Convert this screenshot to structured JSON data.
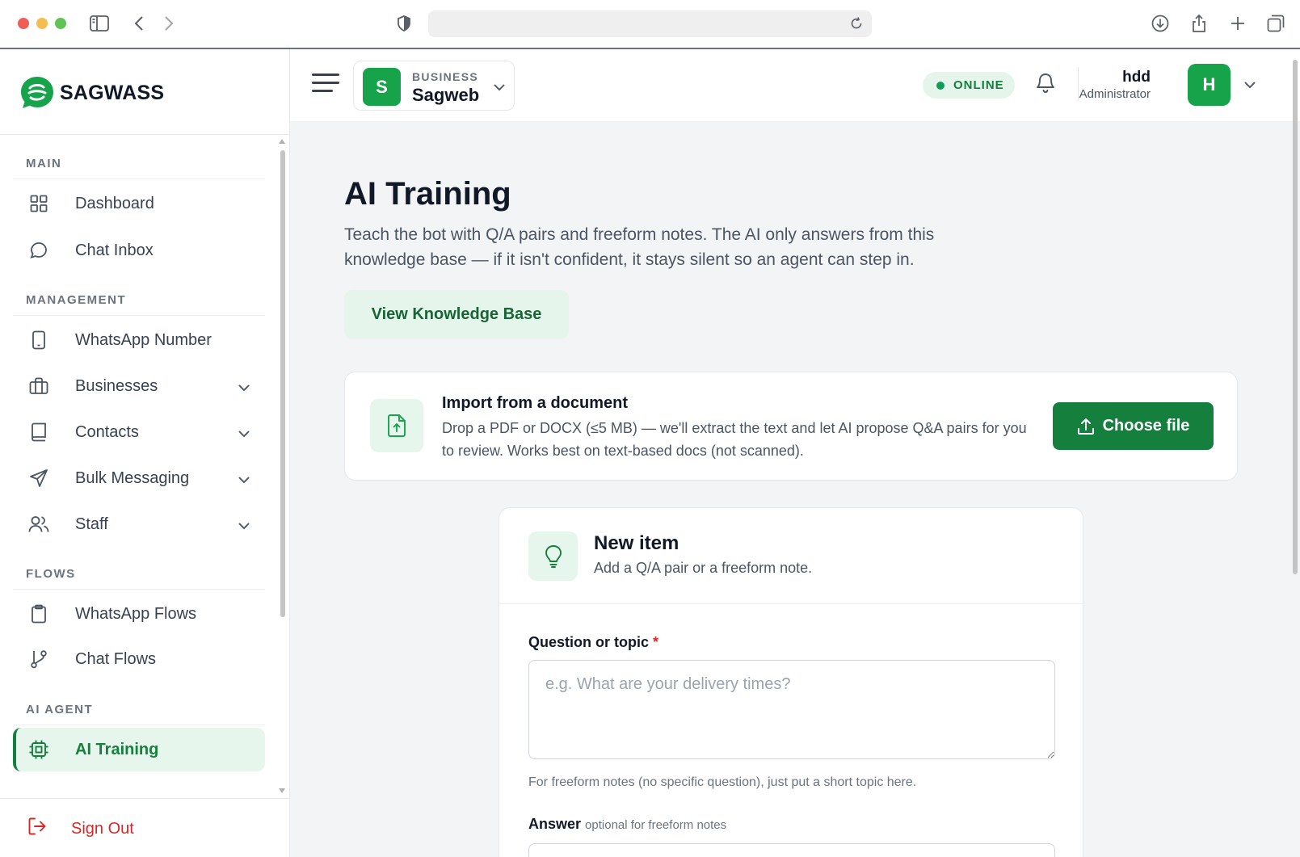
{
  "browser": {
    "url": ""
  },
  "brand": {
    "name": "SAGWASS",
    "accent": "#15803d",
    "accent_light": "#e7f6ec"
  },
  "sidebar": {
    "sections": [
      {
        "title": "MAIN",
        "items": [
          {
            "label": "Dashboard",
            "icon": "grid-icon",
            "expandable": false
          },
          {
            "label": "Chat Inbox",
            "icon": "chat-bubble-icon",
            "expandable": false
          }
        ]
      },
      {
        "title": "MANAGEMENT",
        "items": [
          {
            "label": "WhatsApp Number",
            "icon": "phone-icon",
            "expandable": false
          },
          {
            "label": "Businesses",
            "icon": "briefcase-icon",
            "expandable": true
          },
          {
            "label": "Contacts",
            "icon": "book-icon",
            "expandable": true
          },
          {
            "label": "Bulk Messaging",
            "icon": "send-icon",
            "expandable": true
          },
          {
            "label": "Staff",
            "icon": "users-icon",
            "expandable": true
          }
        ]
      },
      {
        "title": "FLOWS",
        "items": [
          {
            "label": "WhatsApp Flows",
            "icon": "clipboard-icon",
            "expandable": false
          },
          {
            "label": "Chat Flows",
            "icon": "git-branch-icon",
            "expandable": false
          }
        ]
      },
      {
        "title": "AI AGENT",
        "items": [
          {
            "label": "AI Training",
            "icon": "cpu-icon",
            "expandable": false,
            "active": true
          }
        ]
      }
    ],
    "sign_out": "Sign Out"
  },
  "header": {
    "business_kicker": "BUSINESS",
    "business_name": "Sagweb",
    "business_initial": "S",
    "status": "ONLINE",
    "user_name": "hdd",
    "user_role": "Administrator",
    "user_initial": "H"
  },
  "main": {
    "title": "AI Training",
    "subtitle": "Teach the bot with Q/A pairs and freeform notes. The AI only answers from this knowledge base — if it isn't confident, it stays silent so an agent can step in.",
    "kb_button": "View Knowledge Base",
    "import": {
      "title": "Import from a document",
      "description": "Drop a PDF or DOCX (≤5 MB) — we'll extract the text and let AI propose Q&A pairs for you to review. Works best on text-based docs (not scanned).",
      "button": "Choose file"
    },
    "new_item": {
      "title": "New item",
      "subtitle": "Add a Q/A pair or a freeform note.",
      "question_label": "Question or topic",
      "required_mark": "*",
      "question_value": "",
      "question_placeholder": "e.g. What are your delivery times?",
      "question_hint": "For freeform notes (no specific question), just put a short topic here.",
      "answer_label": "Answer",
      "answer_optional": "optional for freeform notes"
    }
  }
}
